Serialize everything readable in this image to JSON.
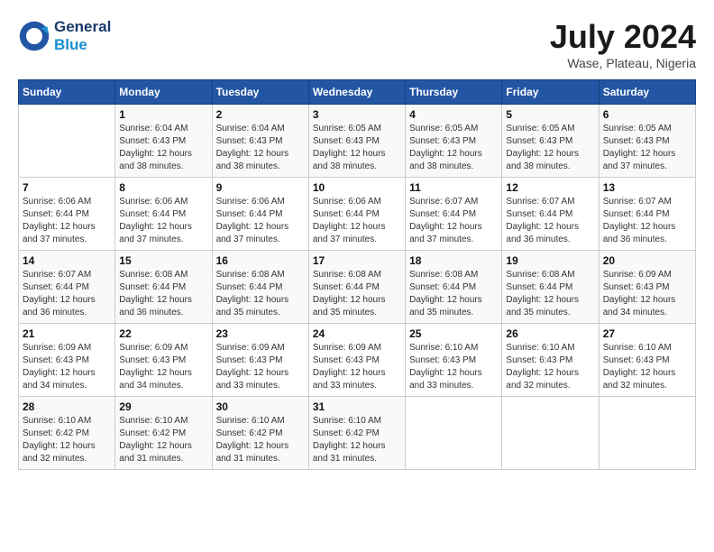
{
  "header": {
    "logo_line1": "General",
    "logo_line2": "Blue",
    "month_year": "July 2024",
    "location": "Wase, Plateau, Nigeria"
  },
  "weekdays": [
    "Sunday",
    "Monday",
    "Tuesday",
    "Wednesday",
    "Thursday",
    "Friday",
    "Saturday"
  ],
  "weeks": [
    [
      {
        "day": "",
        "info": ""
      },
      {
        "day": "1",
        "info": "Sunrise: 6:04 AM\nSunset: 6:43 PM\nDaylight: 12 hours\nand 38 minutes."
      },
      {
        "day": "2",
        "info": "Sunrise: 6:04 AM\nSunset: 6:43 PM\nDaylight: 12 hours\nand 38 minutes."
      },
      {
        "day": "3",
        "info": "Sunrise: 6:05 AM\nSunset: 6:43 PM\nDaylight: 12 hours\nand 38 minutes."
      },
      {
        "day": "4",
        "info": "Sunrise: 6:05 AM\nSunset: 6:43 PM\nDaylight: 12 hours\nand 38 minutes."
      },
      {
        "day": "5",
        "info": "Sunrise: 6:05 AM\nSunset: 6:43 PM\nDaylight: 12 hours\nand 38 minutes."
      },
      {
        "day": "6",
        "info": "Sunrise: 6:05 AM\nSunset: 6:43 PM\nDaylight: 12 hours\nand 37 minutes."
      }
    ],
    [
      {
        "day": "7",
        "info": "Sunrise: 6:06 AM\nSunset: 6:44 PM\nDaylight: 12 hours\nand 37 minutes."
      },
      {
        "day": "8",
        "info": "Sunrise: 6:06 AM\nSunset: 6:44 PM\nDaylight: 12 hours\nand 37 minutes."
      },
      {
        "day": "9",
        "info": "Sunrise: 6:06 AM\nSunset: 6:44 PM\nDaylight: 12 hours\nand 37 minutes."
      },
      {
        "day": "10",
        "info": "Sunrise: 6:06 AM\nSunset: 6:44 PM\nDaylight: 12 hours\nand 37 minutes."
      },
      {
        "day": "11",
        "info": "Sunrise: 6:07 AM\nSunset: 6:44 PM\nDaylight: 12 hours\nand 37 minutes."
      },
      {
        "day": "12",
        "info": "Sunrise: 6:07 AM\nSunset: 6:44 PM\nDaylight: 12 hours\nand 36 minutes."
      },
      {
        "day": "13",
        "info": "Sunrise: 6:07 AM\nSunset: 6:44 PM\nDaylight: 12 hours\nand 36 minutes."
      }
    ],
    [
      {
        "day": "14",
        "info": "Sunrise: 6:07 AM\nSunset: 6:44 PM\nDaylight: 12 hours\nand 36 minutes."
      },
      {
        "day": "15",
        "info": "Sunrise: 6:08 AM\nSunset: 6:44 PM\nDaylight: 12 hours\nand 36 minutes."
      },
      {
        "day": "16",
        "info": "Sunrise: 6:08 AM\nSunset: 6:44 PM\nDaylight: 12 hours\nand 35 minutes."
      },
      {
        "day": "17",
        "info": "Sunrise: 6:08 AM\nSunset: 6:44 PM\nDaylight: 12 hours\nand 35 minutes."
      },
      {
        "day": "18",
        "info": "Sunrise: 6:08 AM\nSunset: 6:44 PM\nDaylight: 12 hours\nand 35 minutes."
      },
      {
        "day": "19",
        "info": "Sunrise: 6:08 AM\nSunset: 6:44 PM\nDaylight: 12 hours\nand 35 minutes."
      },
      {
        "day": "20",
        "info": "Sunrise: 6:09 AM\nSunset: 6:43 PM\nDaylight: 12 hours\nand 34 minutes."
      }
    ],
    [
      {
        "day": "21",
        "info": "Sunrise: 6:09 AM\nSunset: 6:43 PM\nDaylight: 12 hours\nand 34 minutes."
      },
      {
        "day": "22",
        "info": "Sunrise: 6:09 AM\nSunset: 6:43 PM\nDaylight: 12 hours\nand 34 minutes."
      },
      {
        "day": "23",
        "info": "Sunrise: 6:09 AM\nSunset: 6:43 PM\nDaylight: 12 hours\nand 33 minutes."
      },
      {
        "day": "24",
        "info": "Sunrise: 6:09 AM\nSunset: 6:43 PM\nDaylight: 12 hours\nand 33 minutes."
      },
      {
        "day": "25",
        "info": "Sunrise: 6:10 AM\nSunset: 6:43 PM\nDaylight: 12 hours\nand 33 minutes."
      },
      {
        "day": "26",
        "info": "Sunrise: 6:10 AM\nSunset: 6:43 PM\nDaylight: 12 hours\nand 32 minutes."
      },
      {
        "day": "27",
        "info": "Sunrise: 6:10 AM\nSunset: 6:43 PM\nDaylight: 12 hours\nand 32 minutes."
      }
    ],
    [
      {
        "day": "28",
        "info": "Sunrise: 6:10 AM\nSunset: 6:42 PM\nDaylight: 12 hours\nand 32 minutes."
      },
      {
        "day": "29",
        "info": "Sunrise: 6:10 AM\nSunset: 6:42 PM\nDaylight: 12 hours\nand 31 minutes."
      },
      {
        "day": "30",
        "info": "Sunrise: 6:10 AM\nSunset: 6:42 PM\nDaylight: 12 hours\nand 31 minutes."
      },
      {
        "day": "31",
        "info": "Sunrise: 6:10 AM\nSunset: 6:42 PM\nDaylight: 12 hours\nand 31 minutes."
      },
      {
        "day": "",
        "info": ""
      },
      {
        "day": "",
        "info": ""
      },
      {
        "day": "",
        "info": ""
      }
    ]
  ]
}
